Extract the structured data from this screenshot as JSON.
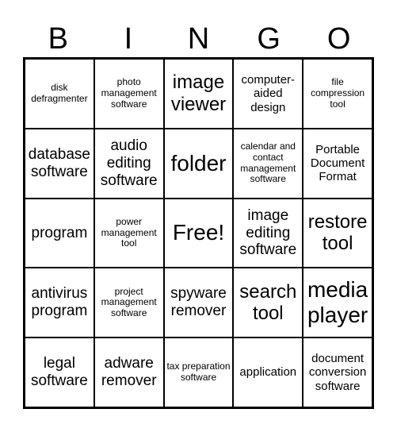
{
  "header": {
    "letters": [
      "B",
      "I",
      "N",
      "G",
      "O"
    ]
  },
  "cells": [
    {
      "text": "disk defragmenter",
      "size": "xs"
    },
    {
      "text": "photo management software",
      "size": "xs"
    },
    {
      "text": "image viewer",
      "size": "lg"
    },
    {
      "text": "computer-aided design",
      "size": "sm"
    },
    {
      "text": "file compression tool",
      "size": "xs"
    },
    {
      "text": "database software",
      "size": "md"
    },
    {
      "text": "audio editing software",
      "size": "md"
    },
    {
      "text": "folder",
      "size": "xl"
    },
    {
      "text": "calendar and contact management software",
      "size": "xs"
    },
    {
      "text": "Portable Document Format",
      "size": "sm"
    },
    {
      "text": "program",
      "size": "md"
    },
    {
      "text": "power management tool",
      "size": "xs"
    },
    {
      "text": "Free!",
      "size": "xl"
    },
    {
      "text": "image editing software",
      "size": "md"
    },
    {
      "text": "restore tool",
      "size": "lg"
    },
    {
      "text": "antivirus program",
      "size": "md"
    },
    {
      "text": "project management software",
      "size": "xs"
    },
    {
      "text": "spyware remover",
      "size": "md"
    },
    {
      "text": "search tool",
      "size": "lg"
    },
    {
      "text": "media player",
      "size": "xl"
    },
    {
      "text": "legal software",
      "size": "md"
    },
    {
      "text": "adware remover",
      "size": "md"
    },
    {
      "text": "tax preparation software",
      "size": "xs"
    },
    {
      "text": "application",
      "size": "sm"
    },
    {
      "text": "document conversion software",
      "size": "sm"
    }
  ]
}
